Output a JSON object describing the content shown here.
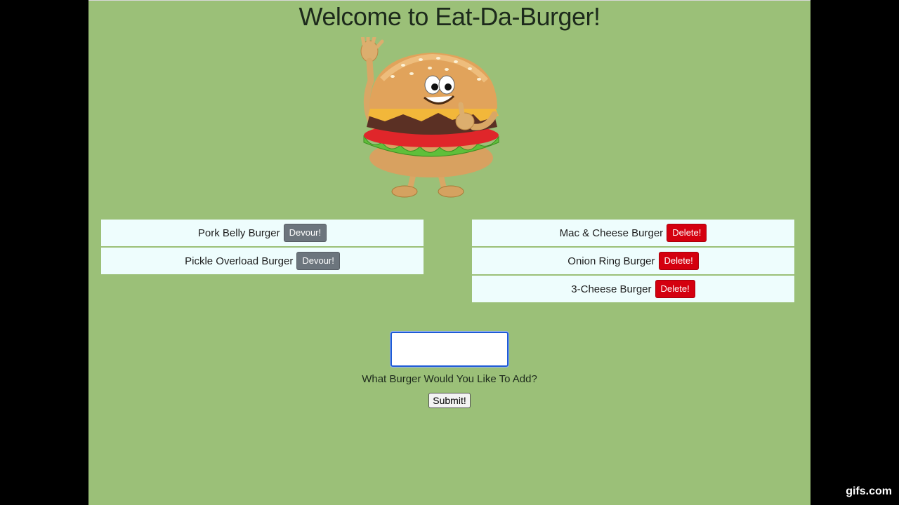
{
  "header": {
    "title": "Welcome to Eat-Da-Burger!"
  },
  "mascot": {
    "icon": "waving-burger-mascot-icon"
  },
  "uneaten": [
    {
      "name": "Pork Belly Burger",
      "button": "Devour!"
    },
    {
      "name": "Pickle Overload Burger",
      "button": "Devour!"
    }
  ],
  "devoured": [
    {
      "name": "Mac & Cheese Burger",
      "button": "Delete!"
    },
    {
      "name": "Onion Ring Burger",
      "button": "Delete!"
    },
    {
      "name": "3-Cheese Burger",
      "button": "Delete!"
    }
  ],
  "form": {
    "value": "",
    "placeholder": "",
    "prompt": "What Burger Would You Like To Add?",
    "submit_label": "Submit!"
  },
  "watermark": "gifs.com",
  "colors": {
    "page_bg": "#9bc078",
    "row_bg": "#eefdfd",
    "devour_button": "#6c757d",
    "delete_button": "#d4000f"
  }
}
